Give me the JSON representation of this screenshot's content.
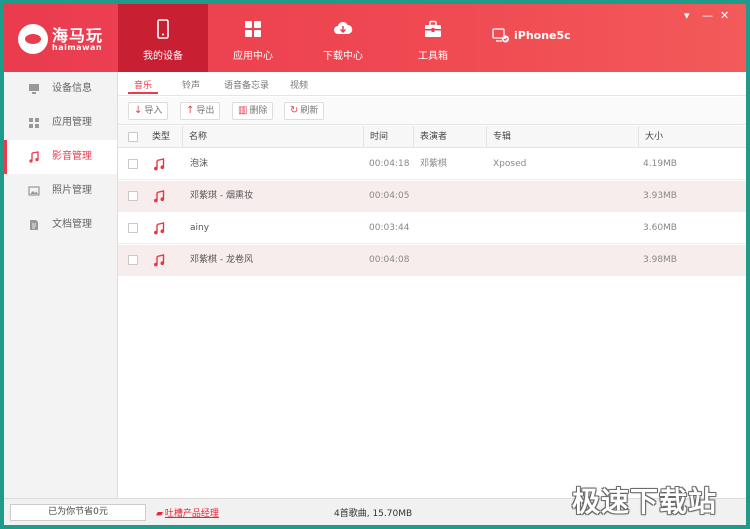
{
  "app": {
    "logo_cn": "海马玩",
    "logo_en": "haimawan"
  },
  "nav": {
    "tabs": [
      {
        "label": "我的设备",
        "icon": "phone-icon",
        "active": true
      },
      {
        "label": "应用中心",
        "icon": "apps-grid-icon",
        "active": false
      },
      {
        "label": "下载中心",
        "icon": "cloud-download-icon",
        "active": false
      },
      {
        "label": "工具箱",
        "icon": "toolbox-icon",
        "active": false
      }
    ],
    "device_name": "iPhone5c"
  },
  "window_controls": {
    "menu": "▾",
    "minimize": "—",
    "close": "✕"
  },
  "sidebar": {
    "items": [
      {
        "label": "设备信息",
        "icon": "monitor-icon",
        "active": false
      },
      {
        "label": "应用管理",
        "icon": "grid-icon",
        "active": false
      },
      {
        "label": "影音管理",
        "icon": "music-note-icon",
        "active": true
      },
      {
        "label": "照片管理",
        "icon": "picture-icon",
        "active": false
      },
      {
        "label": "文档管理",
        "icon": "document-icon",
        "active": false
      }
    ]
  },
  "subtabs": [
    {
      "label": "音乐",
      "active": true
    },
    {
      "label": "铃声",
      "active": false
    },
    {
      "label": "语音备忘录",
      "active": false
    },
    {
      "label": "视频",
      "active": false
    }
  ],
  "toolbar": {
    "import_label": "导入",
    "export_label": "导出",
    "delete_label": "删除",
    "refresh_label": "刷新"
  },
  "table": {
    "headers": {
      "type": "类型",
      "name": "名称",
      "time": "时间",
      "artist": "表演者",
      "album": "专辑",
      "size": "大小"
    },
    "rows": [
      {
        "name": "泡沫",
        "time": "00:04:18",
        "artist": "邓紫棋",
        "album": "Xposed",
        "size": "4.19MB"
      },
      {
        "name": "邓紫琪 - 烟熏妆",
        "time": "00:04:05",
        "artist": "",
        "album": "",
        "size": "3.93MB"
      },
      {
        "name": "ainy",
        "time": "00:03:44",
        "artist": "",
        "album": "",
        "size": "3.60MB"
      },
      {
        "name": "邓紫棋 - 龙卷风",
        "time": "00:04:08",
        "artist": "",
        "album": "",
        "size": "3.98MB"
      }
    ]
  },
  "status": {
    "saved": "已为你节省0元",
    "feedback": "吐槽产品经理",
    "summary": "4首歌曲, 15.70MB"
  },
  "watermark": "极速下载站",
  "colors": {
    "accent": "#ea3b4f",
    "accent_dark": "#c91f33",
    "row_alt": "#f8eded"
  }
}
